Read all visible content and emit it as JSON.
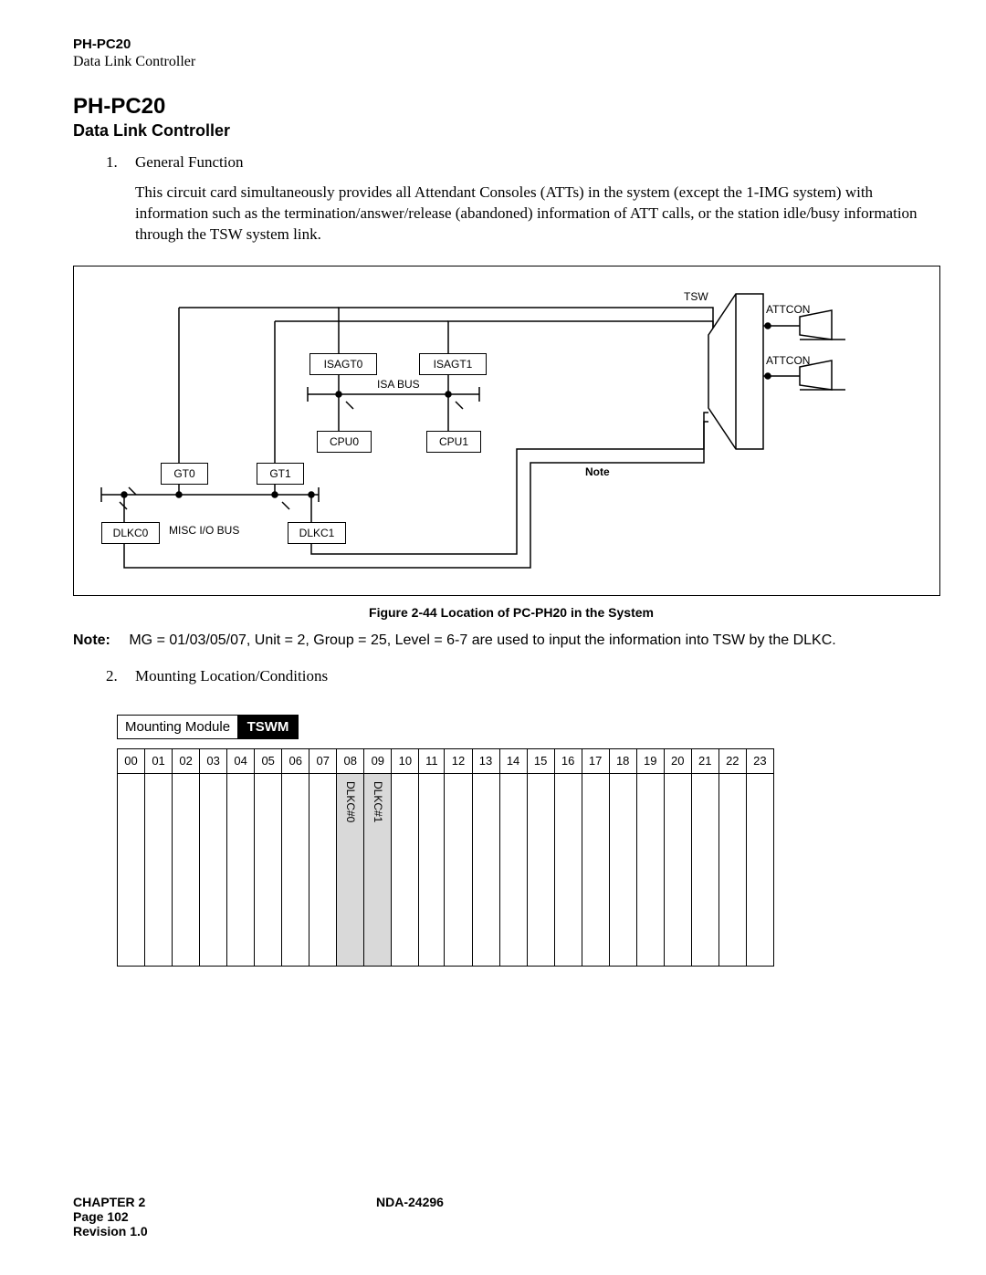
{
  "header": {
    "model": "PH-PC20",
    "subtitle": "Data Link Controller"
  },
  "title": {
    "model": "PH-PC20",
    "subtitle": "Data Link Controller"
  },
  "sections": {
    "item1_num": "1.",
    "item1_label": "General Function",
    "item1_body": "This circuit card simultaneously provides all Attendant Consoles (ATTs) in the system (except the 1-IMG system) with information such as the termination/answer/release (abandoned) information of ATT calls, or the station idle/busy information through the TSW system link.",
    "item2_num": "2.",
    "item2_label": "Mounting Location/Conditions"
  },
  "diagram": {
    "isagt0": "ISAGT0",
    "isagt1": "ISAGT1",
    "isa_bus": "ISA BUS",
    "cpu0": "CPU0",
    "cpu1": "CPU1",
    "gt0": "GT0",
    "gt1": "GT1",
    "dlkc0": "DLKC0",
    "misc_io": "MISC I/O BUS",
    "dlkc1": "DLKC1",
    "tsw": "TSW",
    "attcon1": "ATTCON",
    "attcon2": "ATTCON",
    "note": "Note"
  },
  "figure_caption": "Figure 2-44   Location of PC-PH20 in the System",
  "note": {
    "label": "Note:",
    "text": "MG = 01/03/05/07, Unit = 2, Group = 25, Level = 6-7 are used to input the information into TSW by the DLKC."
  },
  "mounting": {
    "label": "Mounting Module",
    "badge": "TSWM",
    "slots": [
      "00",
      "01",
      "02",
      "03",
      "04",
      "05",
      "06",
      "07",
      "08",
      "09",
      "10",
      "11",
      "12",
      "13",
      "14",
      "15",
      "16",
      "17",
      "18",
      "19",
      "20",
      "21",
      "22",
      "23"
    ],
    "slot_08": "DLKC#0",
    "slot_09": "DLKC#1"
  },
  "footer": {
    "chapter": "CHAPTER 2",
    "doc": "NDA-24296",
    "page": "Page 102",
    "revision": "Revision 1.0"
  }
}
